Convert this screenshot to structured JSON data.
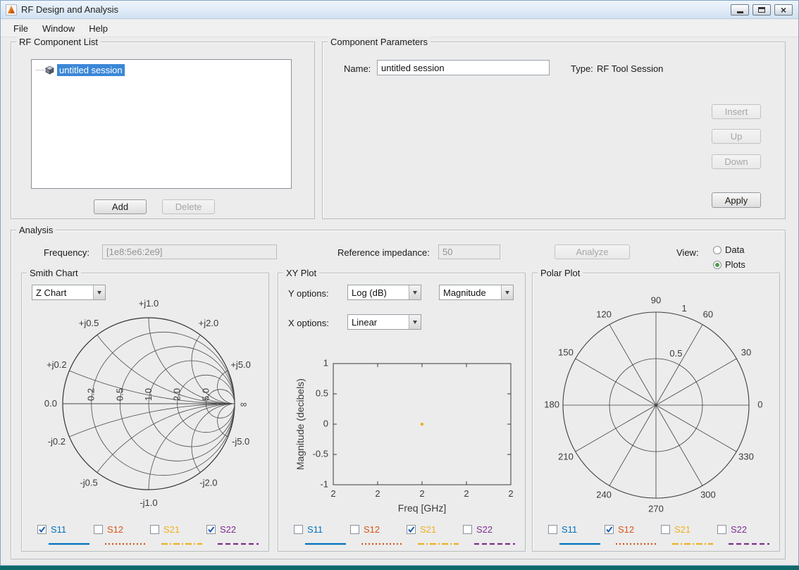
{
  "window": {
    "title": "RF Design and Analysis",
    "menus": [
      "File",
      "Window",
      "Help"
    ]
  },
  "component_list": {
    "title": "RF Component List",
    "session_item": "untitled session",
    "buttons": {
      "add": "Add",
      "delete": "Delete"
    }
  },
  "component_params": {
    "title": "Component Parameters",
    "name_label": "Name:",
    "name_value": "untitled session",
    "type_label": "Type:",
    "type_value": "RF Tool Session",
    "buttons": {
      "insert": "Insert",
      "up": "Up",
      "down": "Down",
      "apply": "Apply"
    }
  },
  "analysis": {
    "title": "Analysis",
    "frequency_label": "Frequency:",
    "frequency_value": "[1e8:5e6:2e9]",
    "impedance_label": "Reference impedance:",
    "impedance_value": "50",
    "analyze_label": "Analyze",
    "view_label": "View:",
    "view_data_label": "Data",
    "view_plots_label": "Plots",
    "view_selected": "Plots"
  },
  "series": [
    {
      "label": "S11",
      "color": "#0072BD",
      "dash": ""
    },
    {
      "label": "S12",
      "color": "#D95319",
      "dash": "2,3"
    },
    {
      "label": "S21",
      "color": "#EDB120",
      "dash": "9,3,2,3"
    },
    {
      "label": "S22",
      "color": "#7E2F8E",
      "dash": "7,4"
    }
  ],
  "smith_panel": {
    "title": "Smith Chart",
    "chart_type_selected": "Z Chart",
    "checked": [
      true,
      false,
      false,
      true
    ]
  },
  "xy_panel": {
    "title": "XY Plot",
    "y_options_label": "Y options:",
    "x_options_label": "X options:",
    "y_scale_selected": "Log (dB)",
    "y_quantity_selected": "Magnitude",
    "x_scale_selected": "Linear",
    "checked": [
      false,
      false,
      true,
      false
    ]
  },
  "polar_panel": {
    "title": "Polar Plot",
    "checked": [
      false,
      true,
      false,
      false
    ]
  },
  "chart_data": [
    {
      "type": "smith",
      "title": "Smith Chart",
      "resistance_circles": [
        0.2,
        0.5,
        1.0,
        2.0,
        5.0
      ],
      "reactance_arcs": [
        0.2,
        0.5,
        1.0,
        2.0,
        5.0
      ],
      "resistance_labels": [
        "0.2",
        "0.5",
        "1.0",
        "2.0",
        "5.0"
      ],
      "reactance_labels_top": [
        "+j0.2",
        "+j0.5",
        "+j1.0",
        "+j2.0",
        "+j5.0"
      ],
      "reactance_labels_bottom": [
        "-j0.2",
        "-j0.5",
        "-j1.0",
        "-j2.0",
        "-j5.0"
      ],
      "axis_labels": {
        "left": "0.0",
        "right": "∞"
      }
    },
    {
      "type": "scatter",
      "xlabel": "Freq [GHz]",
      "ylabel": "Magnitude (decibels)",
      "ylim": [
        -1,
        1
      ],
      "y_ticks": [
        "1",
        "0.5",
        "0",
        "-0.5",
        "-1"
      ],
      "x_ticks": [
        "2",
        "2",
        "2",
        "2",
        "2"
      ],
      "points": [
        {
          "x_frac": 0.5,
          "y": 0,
          "color": "#EDB120",
          "series": "S21"
        }
      ]
    },
    {
      "type": "polar",
      "angle_labels": [
        "0",
        "30",
        "60",
        "90",
        "120",
        "150",
        "180",
        "210",
        "240",
        "270",
        "300",
        "330"
      ],
      "radii": [
        0.5,
        1
      ],
      "radius_labels": [
        "0.5",
        "1"
      ]
    }
  ]
}
